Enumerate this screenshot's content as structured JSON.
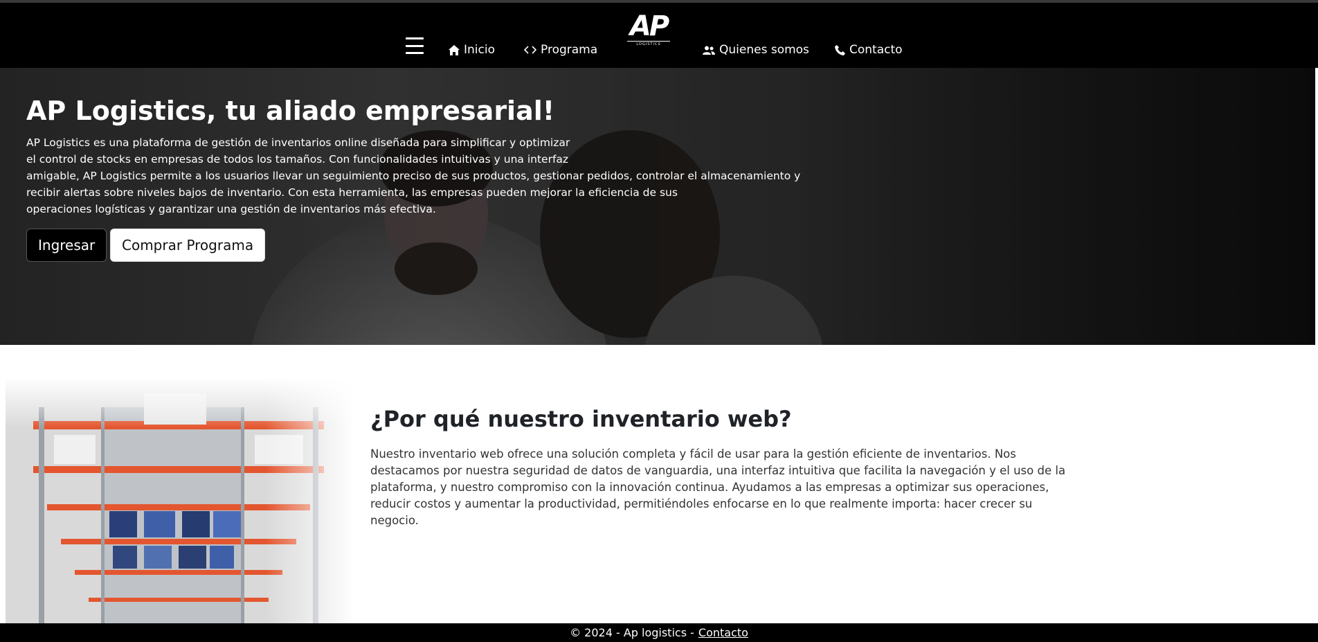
{
  "nav": {
    "items": [
      {
        "label": "Inicio",
        "icon": "home-icon"
      },
      {
        "label": "Programa",
        "icon": "code-icon"
      },
      {
        "label": "Quienes somos",
        "icon": "users-icon"
      },
      {
        "label": "Contacto",
        "icon": "phone-icon"
      }
    ],
    "logo_text": "AP",
    "logo_sub": "LOGISTICS",
    "menu_icon": "hamburger-icon"
  },
  "hero": {
    "title": "AP Logistics, tu aliado empresarial!",
    "lines": [
      "AP Logistics es una plataforma de gestión de inventarios online diseñada para simplificar y optimizar",
      "el control de stocks en empresas de todos los tamaños. Con funcionalidades intuitivas y una interfaz",
      "amigable, AP Logistics permite a los usuarios llevar un seguimiento preciso de sus productos, gestionar pedidos, controlar el almacenamiento y",
      "recibir alertas sobre niveles bajos de inventario. Con esta herramienta, las empresas pueden mejorar la eficiencia de sus",
      "operaciones logísticas y garantizar una gestión de inventarios más efectiva."
    ],
    "btn_ingresar": "Ingresar",
    "btn_comprar": "Comprar Programa"
  },
  "why": {
    "title": "¿Por qué nuestro inventario web?",
    "lines": [
      "Nuestro inventario web ofrece una solución completa y fácil de usar para la gestión eficiente de inventarios. Nos",
      "destacamos por nuestra seguridad de datos de vanguardia, una interfaz intuitiva que facilita la navegación y el uso de la",
      "plataforma, y nuestro compromiso con la innovación continua. Ayudamos a las empresas a optimizar sus operaciones,",
      "reducir costos y aumentar la productividad, permitiéndoles enfocarse en lo que realmente importa: hacer crecer su",
      "negocio."
    ]
  },
  "footer": {
    "copyright": "© 2024 - Ap logistics -",
    "link": "Contacto"
  },
  "colors": {
    "nav_bg": "#000000",
    "footer_bg": "#000000",
    "rack_orange": "#e3562f"
  }
}
